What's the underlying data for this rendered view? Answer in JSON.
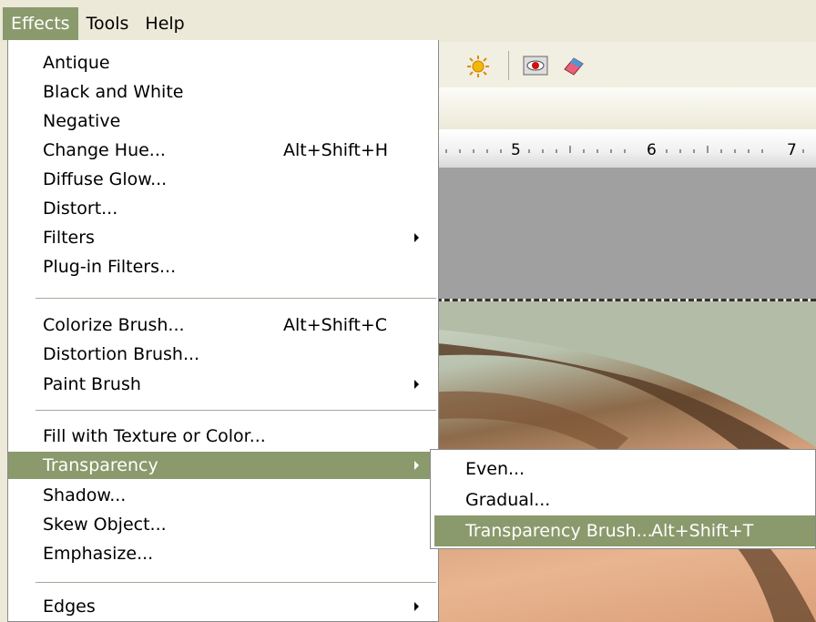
{
  "menubar": {
    "items": [
      "Effects",
      "Tools",
      "Help"
    ]
  },
  "colors": {
    "highlight": "#8a9a6c",
    "chrome": "#ece9d8"
  },
  "ruler": {
    "labels": [
      "5",
      "6",
      "7"
    ]
  },
  "toolbar": {
    "icons": [
      "green-shape-icon",
      "sun-icon",
      "red-eye-icon",
      "eraser-icon"
    ]
  },
  "effects_menu": {
    "group1": [
      {
        "label": "Antique"
      },
      {
        "label": "Black and White"
      },
      {
        "label": "Negative"
      },
      {
        "label": "Change Hue...",
        "shortcut": "Alt+Shift+H"
      },
      {
        "label": "Diffuse Glow..."
      },
      {
        "label": "Distort..."
      },
      {
        "label": "Filters",
        "submenu": true
      },
      {
        "label": "Plug-in Filters..."
      }
    ],
    "group2": [
      {
        "label": "Colorize Brush...",
        "shortcut": "Alt+Shift+C"
      },
      {
        "label": "Distortion Brush..."
      },
      {
        "label": "Paint Brush",
        "submenu": true
      }
    ],
    "group3": [
      {
        "label": "Fill with Texture or Color..."
      },
      {
        "label": "Transparency",
        "submenu": true
      },
      {
        "label": "Shadow..."
      },
      {
        "label": "Skew Object..."
      },
      {
        "label": "Emphasize..."
      }
    ],
    "group4": [
      {
        "label": "Edges",
        "submenu": true
      }
    ]
  },
  "transparency_submenu": [
    {
      "label": "Even..."
    },
    {
      "label": "Gradual..."
    },
    {
      "label": "Transparency Brush...",
      "shortcut": "Alt+Shift+T"
    }
  ]
}
